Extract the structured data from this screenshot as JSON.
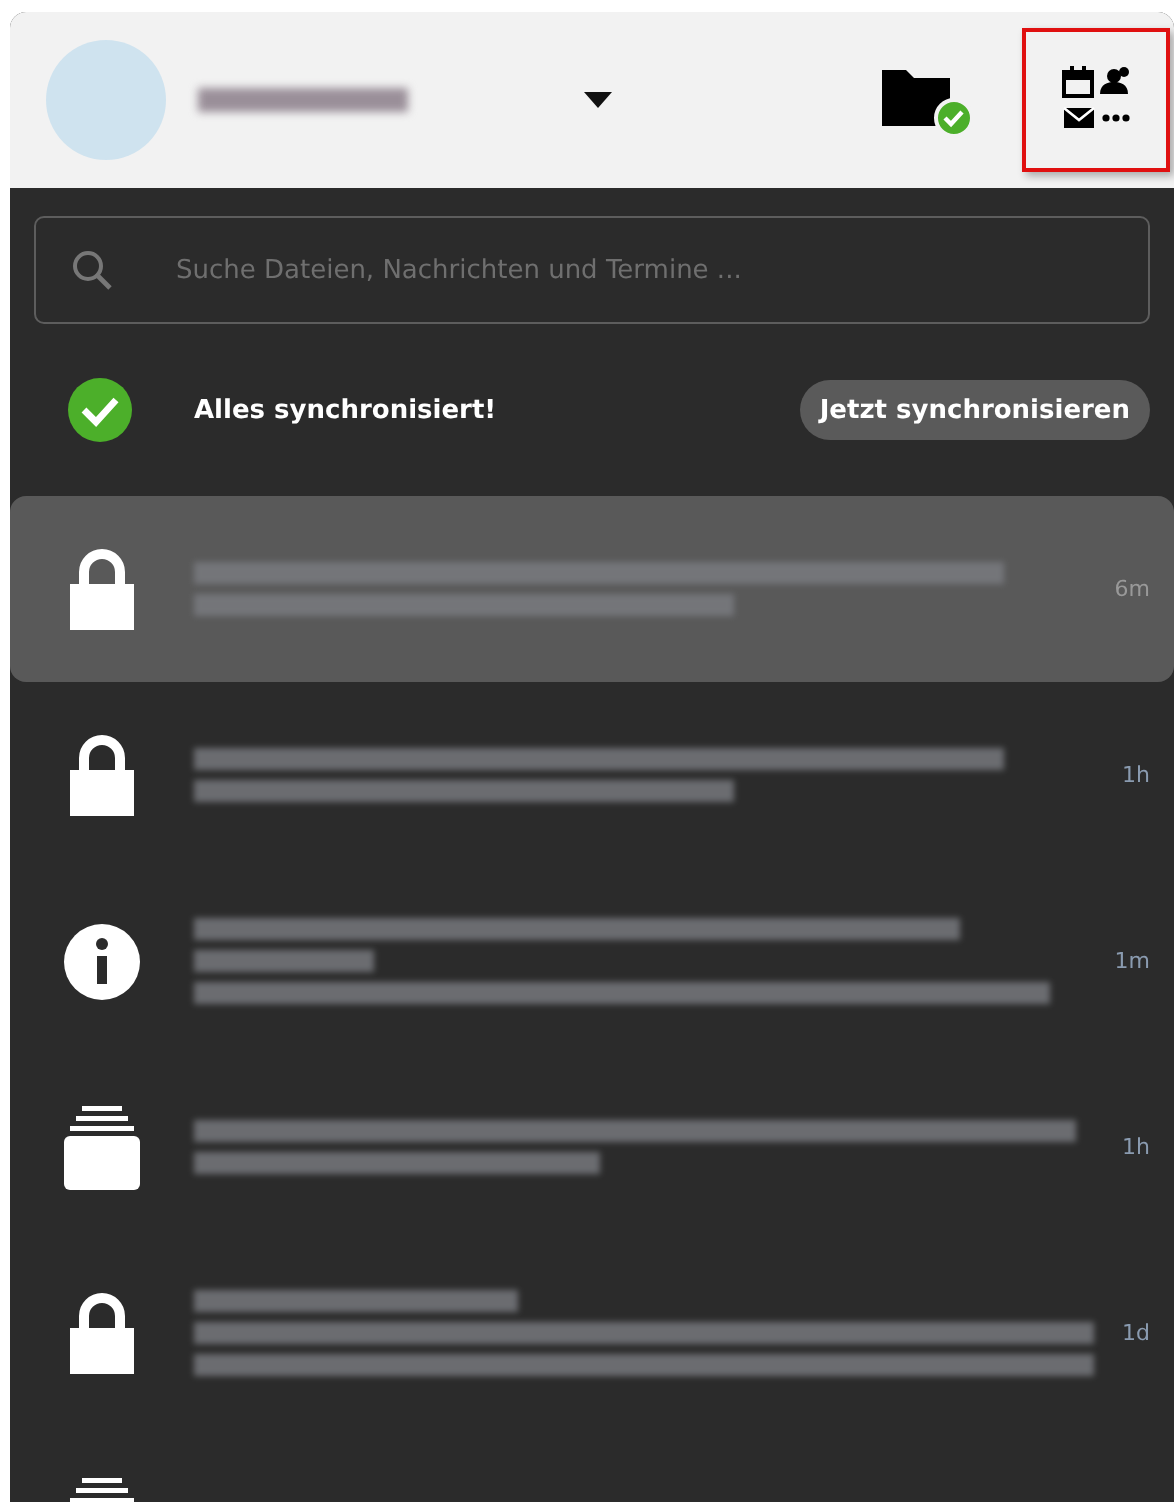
{
  "header": {
    "apps_highlighted": true
  },
  "search": {
    "placeholder": "Suche Dateien, Nachrichten und Termine ..."
  },
  "sync": {
    "status": "Alles synchronisiert!",
    "button": "Jetzt synchronisieren"
  },
  "notifications": [
    {
      "kind": "lock",
      "time": "6m",
      "selected": true
    },
    {
      "kind": "lock",
      "time": "1h",
      "selected": false
    },
    {
      "kind": "info",
      "time": "1m",
      "selected": false
    },
    {
      "kind": "stack",
      "time": "1h",
      "selected": false
    },
    {
      "kind": "lock",
      "time": "1d",
      "selected": false
    },
    {
      "kind": "stack",
      "selected": false
    }
  ]
}
